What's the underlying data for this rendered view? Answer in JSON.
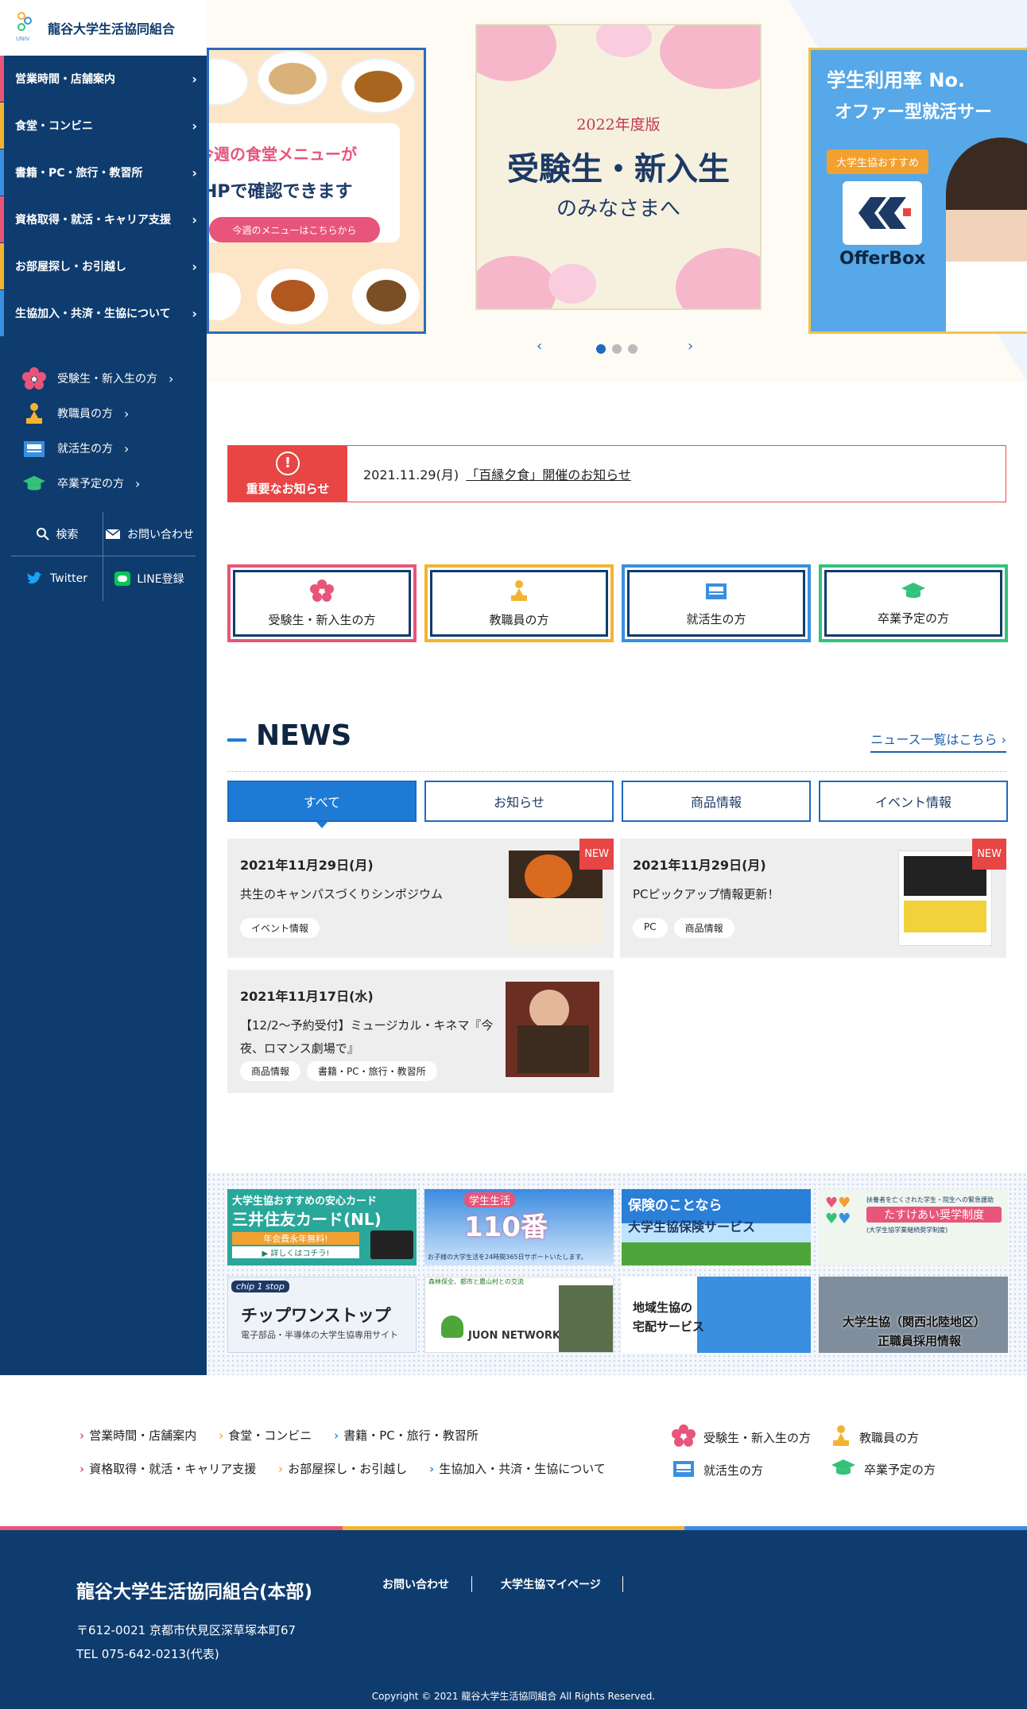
{
  "org_name": "龍谷大学生活協同組合",
  "sidebar": {
    "categories": [
      {
        "label": "営業時間・店舗案内",
        "color": "#e8557a"
      },
      {
        "label": "食堂・コンビニ",
        "color": "#f2b430"
      },
      {
        "label": "書籍・PC・旅行・教習所",
        "color": "#3a8fe0"
      },
      {
        "label": "資格取得・就活・キャリア支援",
        "color": "#e8557a"
      },
      {
        "label": "お部屋探し・お引越し",
        "color": "#f2b430"
      },
      {
        "label": "生協加入・共済・生協について",
        "color": "#3a8fe0"
      }
    ],
    "users": [
      {
        "label": "受験生・新入生の方",
        "icon": "cherry-blossom-icon"
      },
      {
        "label": "教職員の方",
        "icon": "teacher-icon"
      },
      {
        "label": "就活生の方",
        "icon": "briefcase-icon"
      },
      {
        "label": "卒業予定の方",
        "icon": "graduation-cap-icon"
      }
    ],
    "search": "検索",
    "contact": "お問い合わせ",
    "twitter": "Twitter",
    "line": "LINE登録"
  },
  "hero": {
    "slide_left": {
      "line1": "今週の食堂メニューが",
      "line2": "HPで確認できます",
      "button": "今週のメニューはこちらから"
    },
    "slide_center": {
      "year": "2022年度版",
      "title": "受験生・新入生",
      "sub": "のみなさまへ"
    },
    "slide_right": {
      "line1": "学生利用率 No.",
      "line2": "オファー型就活サー",
      "badge": "大学生協おすすめ",
      "brand": "OfferBox"
    },
    "prev": "‹",
    "next": "›"
  },
  "alert": {
    "label": "重要なお知らせ",
    "icon": "!",
    "date": "2021.11.29(月)",
    "text": "「百縁夕食」開催のお知らせ"
  },
  "user_buttons": [
    {
      "label": "受験生・新入生の方",
      "color": "#e8557a"
    },
    {
      "label": "教職員の方",
      "color": "#f2b430"
    },
    {
      "label": "就活生の方",
      "color": "#3a8fe0"
    },
    {
      "label": "卒業予定の方",
      "color": "#34c27a"
    }
  ],
  "news": {
    "title": "NEWS",
    "more": "ニュース一覧はこちら",
    "tabs": [
      "すべて",
      "お知らせ",
      "商品情報",
      "イベント情報"
    ],
    "items": [
      {
        "date": "2021年11月29日(月)",
        "title": "共生のキャンパスづくりシンポジウム",
        "tags": [
          "イベント情報"
        ],
        "new": "NEW"
      },
      {
        "date": "2021年11月29日(月)",
        "title": "PCピックアップ情報更新！",
        "tags": [
          "PC",
          "商品情報"
        ],
        "new": "NEW"
      },
      {
        "date": "2021年11月17日(水)",
        "title": "【12/2〜予約受付】ミュージカル・キネマ『今夜、ロマンス劇場で』",
        "tags": [
          "商品情報",
          "書籍・PC・旅行・教習所"
        ]
      }
    ]
  },
  "banners": [
    {
      "l1": "大学生協おすすめの安心カード",
      "l2": "三井住友カード(NL)",
      "l3": "年会費永年無料!",
      "l4": "▶ 詳しくはコチラ!"
    },
    {
      "l1": "学生生活",
      "l2": "110番",
      "l3": "お子様の大学生活を24時間365日サポートいたします。"
    },
    {
      "l1": "保険のことなら",
      "l2": "大学生協保険サービス"
    },
    {
      "l1": "扶養者を亡くされた学生・院生への緊急援助",
      "l2": "たすけあい奨学制度",
      "l3": "(大学生協学業継続奨学制度)"
    },
    {
      "l1": "chip 1 stop",
      "l2": "チップワンストップ",
      "l3": "電子部品・半導体の大学生協専用サイト"
    },
    {
      "l1": "森林保全、都市と農山村との交流",
      "l2": "JUON NETWORK"
    },
    {
      "l1": "地域生協の",
      "l2": "宅配サービス"
    },
    {
      "l1": "大学生協（関西北陸地区）",
      "l2": "正職員採用情報"
    }
  ],
  "footer_links": [
    "営業時間・店舗案内",
    "食堂・コンビニ",
    "書籍・PC・旅行・教習所",
    "資格取得・就活・キャリア支援",
    "お部屋探し・お引越し",
    "生協加入・共済・生協について"
  ],
  "footer_users": [
    "受験生・新入生の方",
    "教職員の方",
    "就活生の方",
    "卒業予定の方"
  ],
  "footer": {
    "org": "龍谷大学生活協同組合(本部)",
    "address": "〒612-0021 京都市伏見区深草塚本町67",
    "tel": "TEL 075-642-0213(代表)",
    "contact": "お問い合わせ",
    "mypage": "大学生協マイページ",
    "copyright": "Copyright © 2021 龍谷大学生活協同組合 All Rights Reserved."
  }
}
